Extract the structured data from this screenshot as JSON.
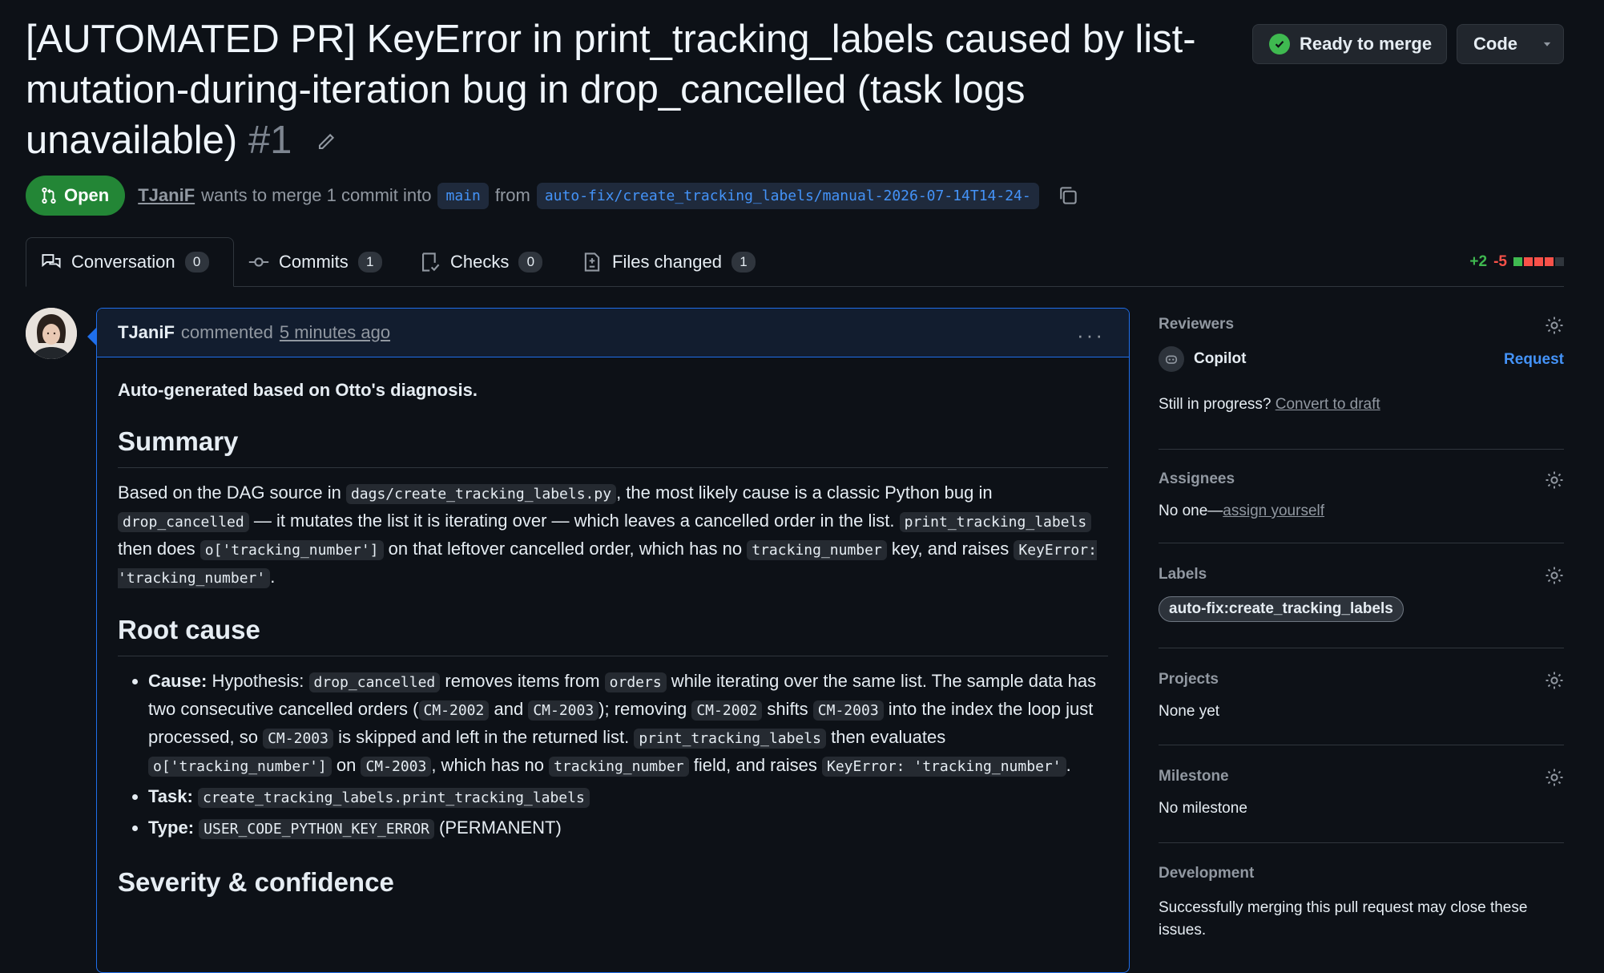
{
  "pr": {
    "title": "[AUTOMATED PR] KeyError in print_tracking_labels caused by list-mutation-during-iteration bug in drop_cancelled (task logs unavailable)",
    "number": "#1"
  },
  "header": {
    "ready_label": "Ready to merge",
    "code_label": "Code"
  },
  "meta": {
    "status": "Open",
    "user": "TJaniF",
    "action_text": "wants to merge 1 commit into",
    "base_branch": "main",
    "from_text": "from",
    "head_branch": "auto-fix/create_tracking_labels/manual-2026-07-14T14-24-"
  },
  "tabs": [
    {
      "label": "Conversation",
      "count": "0"
    },
    {
      "label": "Commits",
      "count": "1"
    },
    {
      "label": "Checks",
      "count": "0"
    },
    {
      "label": "Files changed",
      "count": "1"
    }
  ],
  "diffstat": {
    "additions": "+2",
    "deletions": "-5",
    "green": "#3fb950",
    "red": "#f85149"
  },
  "comment": {
    "author": "TJaniF",
    "action": "commented",
    "time": "5 minutes ago",
    "intro": "Auto-generated based on Otto's diagnosis.",
    "summary_heading": "Summary",
    "summary": {
      "t1": "Based on the DAG source in",
      "c1": "dags/create_tracking_labels.py",
      "t2": ", the most likely cause is a classic Python bug in",
      "c2": "drop_cancelled",
      "t3": " — it mutates the list it is iterating over — which leaves a cancelled order in the list.",
      "c3": "print_tracking_labels",
      "t4": " then does",
      "c4": "o['tracking_number']",
      "t5": " on that leftover cancelled order, which has no",
      "c5": "tracking_number",
      "t6": " key, and raises",
      "c6": "KeyError: 'tracking_number'",
      "t7": "."
    },
    "root_heading": "Root cause",
    "cause": {
      "label": "Cause:",
      "t1": " Hypothesis:",
      "c1": "drop_cancelled",
      "t2": " removes items from",
      "c2": "orders",
      "t3": " while iterating over the same list. The sample data has two consecutive cancelled orders (",
      "c3": "CM-2002",
      "t4": " and",
      "c4": "CM-2003",
      "t5": "); removing",
      "c5": "CM-2002",
      "t6": " shifts",
      "c6": "CM-2003",
      "t7": " into the index the loop just processed, so",
      "c7": "CM-2003",
      "t8": " is skipped and left in the returned list.",
      "c8": "print_tracking_labels",
      "t9": " then evaluates",
      "c9": "o['tracking_number']",
      "t10": " on",
      "c10": "CM-2003",
      "t11": ", which has no",
      "c11": "tracking_number",
      "t12": " field, and raises",
      "c12": "KeyError: 'tracking_number'",
      "t13": "."
    },
    "task": {
      "label": "Task:",
      "value": "create_tracking_labels.print_tracking_labels"
    },
    "type": {
      "label": "Type:",
      "value": "USER_CODE_PYTHON_KEY_ERROR",
      "suffix": " (PERMANENT)"
    },
    "severity_heading": "Severity & confidence"
  },
  "sidebar": {
    "reviewers": {
      "heading": "Reviewers",
      "name": "Copilot",
      "request": "Request",
      "progress_text": "Still in progress?",
      "draft_link": "Convert to draft"
    },
    "assignees": {
      "heading": "Assignees",
      "text": "No one—",
      "link": "assign yourself"
    },
    "labels": {
      "heading": "Labels",
      "label": "auto-fix:create_tracking_labels"
    },
    "projects": {
      "heading": "Projects",
      "text": "None yet"
    },
    "milestone": {
      "heading": "Milestone",
      "text": "No milestone"
    },
    "development": {
      "heading": "Development",
      "text": "Successfully merging this pull request may close these issues."
    }
  }
}
